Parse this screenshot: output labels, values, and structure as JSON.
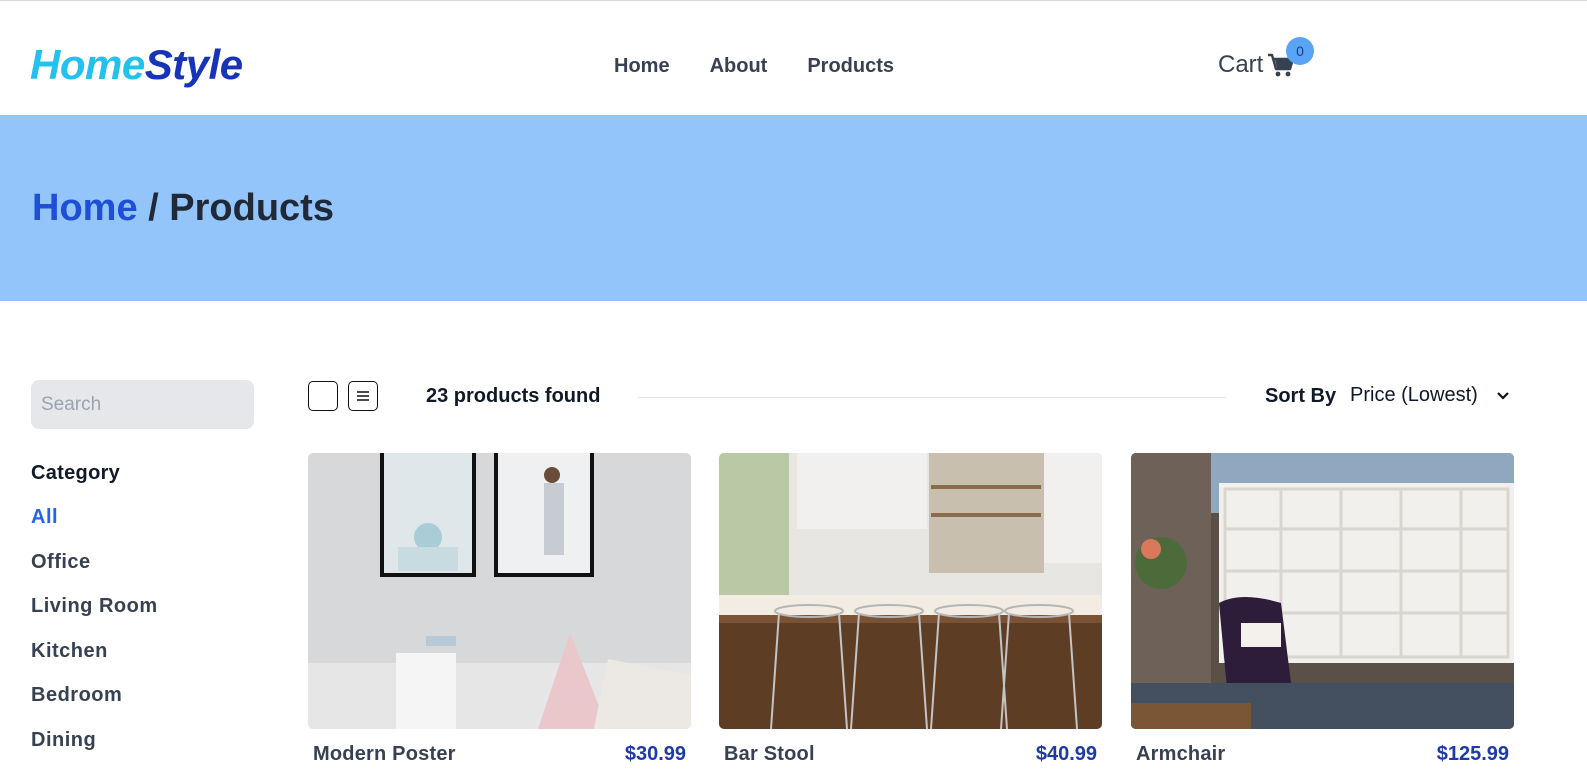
{
  "brand": {
    "part1": "Home",
    "part2": "Style"
  },
  "nav": {
    "links": [
      "Home",
      "About",
      "Products"
    ]
  },
  "cart": {
    "label": "Cart",
    "count": "0"
  },
  "breadcrumb": {
    "home": "Home",
    "separator": " / ",
    "current": "Products"
  },
  "sidebar": {
    "search_placeholder": "Search",
    "category_title": "Category",
    "categories": [
      "All",
      "Office",
      "Living Room",
      "Kitchen",
      "Bedroom",
      "Dining"
    ],
    "active_category": "All"
  },
  "toolbar": {
    "products_found": "23 products found",
    "sort_label": "Sort By",
    "sort_value": "Price (Lowest)"
  },
  "products": [
    {
      "name": "Modern Poster",
      "price": "$30.99"
    },
    {
      "name": "Bar Stool",
      "price": "$40.99"
    },
    {
      "name": "Armchair",
      "price": "$125.99"
    }
  ],
  "colors": {
    "brand_light": "#22c1ee",
    "brand_dark": "#1733b8",
    "hero_bg": "#93c4fa",
    "active_link": "#2563eb",
    "price": "#1e3aa8",
    "badge": "#5aa4f5"
  }
}
